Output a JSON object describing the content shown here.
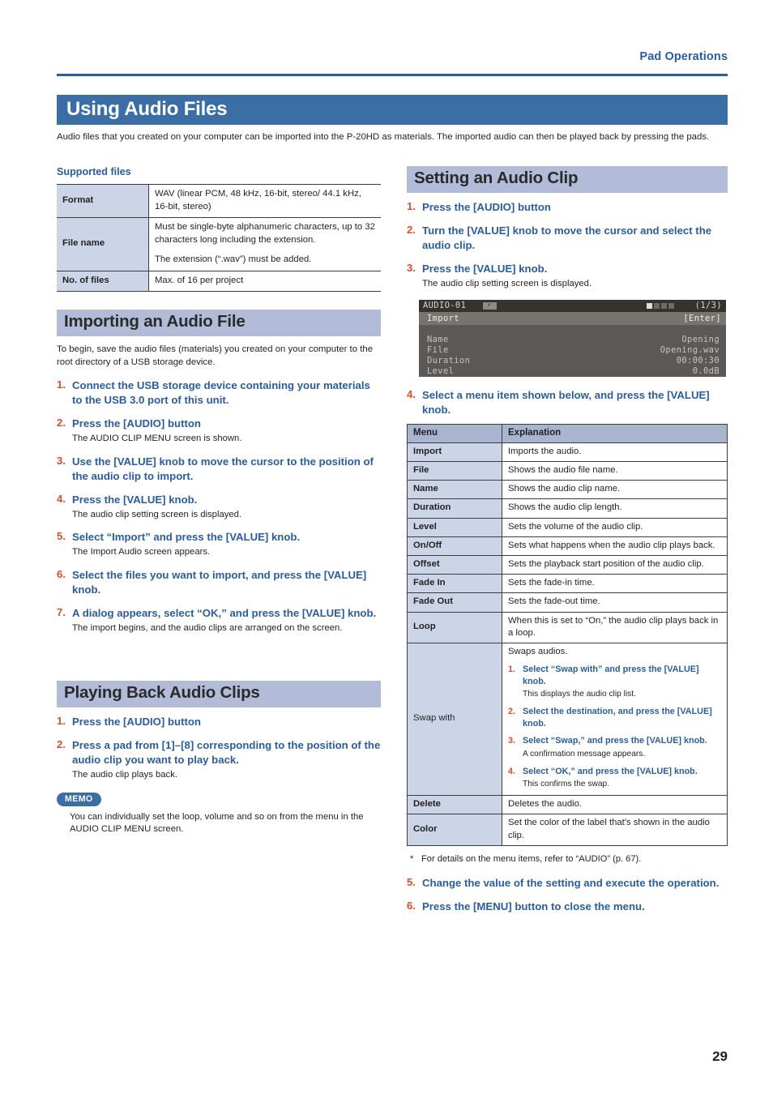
{
  "header": {
    "running_head": "Pad Operations",
    "page_number": "29"
  },
  "chapter": {
    "title": "Using Audio Files",
    "intro": "Audio files that you created on your computer can be imported into the P-20HD as materials. The imported audio can then be played back by pressing the pads."
  },
  "supported_files": {
    "heading": "Supported files",
    "rows": [
      {
        "label": "Format",
        "value": "WAV (linear PCM, 48 kHz, 16-bit, stereo/ 44.1 kHz, 16-bit, stereo)"
      },
      {
        "label": "File name",
        "value": "Must be single-byte alphanumeric characters, up to 32 characters long including the extension.",
        "value2": "The extension (“.wav”) must be added."
      },
      {
        "label": "No. of files",
        "value": "Max. of 16 per project"
      }
    ]
  },
  "importing": {
    "title": "Importing an Audio File",
    "intro": "To begin, save the audio files (materials) you created on your computer to the root directory of a USB storage device.",
    "steps": [
      {
        "num": "1.",
        "title": "Connect the USB storage device containing your materials to the USB 3.0 port of this unit.",
        "desc": ""
      },
      {
        "num": "2.",
        "title": "Press the [AUDIO] button",
        "desc": "The AUDIO CLIP MENU screen is shown."
      },
      {
        "num": "3.",
        "title": "Use the [VALUE] knob to move the cursor to the position of the audio clip to import.",
        "desc": ""
      },
      {
        "num": "4.",
        "title": "Press the [VALUE] knob.",
        "desc": "The audio clip setting screen is displayed."
      },
      {
        "num": "5.",
        "title": "Select “Import” and press the [VALUE] knob.",
        "desc": "The Import Audio screen appears."
      },
      {
        "num": "6.",
        "title": "Select the files you want to import, and press the [VALUE] knob.",
        "desc": ""
      },
      {
        "num": "7.",
        "title": "A dialog appears, select “OK,” and press the [VALUE] knob.",
        "desc": "The import begins, and the audio clips are arranged on the screen."
      }
    ]
  },
  "playing": {
    "title": "Playing Back Audio Clips",
    "steps": [
      {
        "num": "1.",
        "title": "Press the [AUDIO] button",
        "desc": ""
      },
      {
        "num": "2.",
        "title": "Press a pad from [1]–[8] corresponding to the position of the audio clip you want to play back.",
        "desc": "The audio clip plays back."
      }
    ],
    "memo_label": "MEMO",
    "memo_text": "You can individually set the loop, volume and so on from the menu in the AUDIO CLIP MENU screen."
  },
  "setting": {
    "title": "Setting an Audio Clip",
    "steps_top": [
      {
        "num": "1.",
        "title": "Press the [AUDIO] button",
        "desc": ""
      },
      {
        "num": "2.",
        "title": "Turn the [VALUE] knob to move the cursor and select the audio clip.",
        "desc": ""
      },
      {
        "num": "3.",
        "title": "Press the [VALUE] knob.",
        "desc": "The audio clip setting screen is displayed."
      }
    ],
    "step4": {
      "num": "4.",
      "title": "Select a menu item shown below, and press the [VALUE] knob."
    },
    "steps_bottom": [
      {
        "num": "5.",
        "title": "Change the value of the setting and execute the operation.",
        "desc": ""
      },
      {
        "num": "6.",
        "title": "Press the [MENU] button to close the menu.",
        "desc": ""
      }
    ],
    "footnote": "For details on the menu items, refer to “AUDIO” (p. 67).",
    "footnote_marker": "*"
  },
  "lcd": {
    "title_left": "AUDIO-01",
    "title_right": "(1/3)",
    "menu_left": "Import",
    "menu_right": "[Enter]",
    "rows": [
      {
        "key": "Name",
        "value": "Opening"
      },
      {
        "key": "File",
        "value": "Opening.wav"
      },
      {
        "key": "Duration",
        "value": "00:00:30"
      },
      {
        "key": "Level",
        "value": "0.0dB"
      }
    ],
    "page_dots": [
      true,
      false,
      false,
      false
    ]
  },
  "menu_table": {
    "headers": [
      "Menu",
      "Explanation"
    ],
    "rows": [
      {
        "menu": "Import",
        "explanation": "Imports the audio."
      },
      {
        "menu": "File",
        "explanation": "Shows the audio file name."
      },
      {
        "menu": "Name",
        "explanation": "Shows the audio clip name."
      },
      {
        "menu": "Duration",
        "explanation": "Shows the audio clip length."
      },
      {
        "menu": "Level",
        "explanation": "Sets the volume of the audio clip."
      },
      {
        "menu": "On/Off",
        "explanation": "Sets what happens when the audio clip plays back."
      },
      {
        "menu": "Offset",
        "explanation": "Sets the playback start position of the audio clip."
      },
      {
        "menu": "Fade In",
        "explanation": "Sets the fade-in time."
      },
      {
        "menu": "Fade Out",
        "explanation": "Sets the fade-out time."
      },
      {
        "menu": "Loop",
        "explanation": "When this is set to “On,” the audio clip plays back in a loop."
      },
      {
        "menu": "Delete",
        "explanation": "Deletes the audio."
      },
      {
        "menu": "Color",
        "explanation": "Set the color of the label that's shown in the audio clip."
      }
    ],
    "swap_row": {
      "menu": "Swap with",
      "lead": "Swaps audios.",
      "steps": [
        {
          "num": "1.",
          "title": "Select “Swap with” and press the [VALUE] knob.",
          "desc": "This displays the audio clip list."
        },
        {
          "num": "2.",
          "title": "Select the destination, and press the [VALUE] knob.",
          "desc": ""
        },
        {
          "num": "3.",
          "title": "Select “Swap,” and press the [VALUE] knob.",
          "desc": "A confirmation message appears."
        },
        {
          "num": "4.",
          "title": "Select “OK,” and press the [VALUE] knob.",
          "desc": "This confirms the swap."
        }
      ]
    }
  },
  "colors": {
    "brand_blue": "#2a5d9e",
    "chapter_bar": "#3b6ea5",
    "subhead_bar": "#b2bcd8",
    "table_header": "#a9b4d1",
    "table_label": "#ccd5e7",
    "step_number": "#d94f2b",
    "lcd_bg": "#5b5856"
  }
}
